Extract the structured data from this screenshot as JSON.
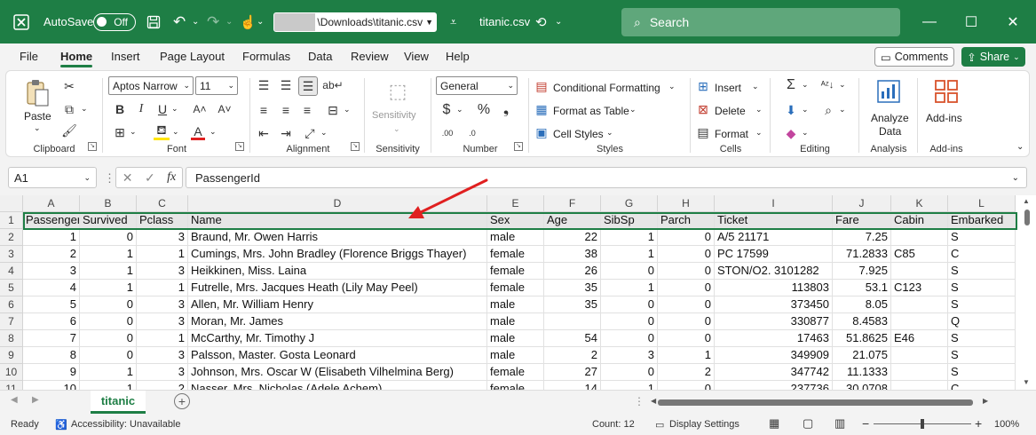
{
  "titlebar": {
    "autosave_label": "AutoSave",
    "autosave_state": "Off",
    "path": "\\Downloads\\titanic.csv",
    "filename": "titanic.csv",
    "search_placeholder": "Search"
  },
  "ribbon_tabs": [
    "File",
    "Home",
    "Insert",
    "Page Layout",
    "Formulas",
    "Data",
    "Review",
    "View",
    "Help"
  ],
  "active_tab": "Home",
  "comments_label": "Comments",
  "share_label": "Share",
  "ribbon": {
    "clipboard": {
      "paste": "Paste",
      "label": "Clipboard"
    },
    "font": {
      "name": "Aptos Narrow",
      "size": "11",
      "label": "Font"
    },
    "alignment": {
      "label": "Alignment"
    },
    "sensitivity": {
      "button": "Sensitivity",
      "label": "Sensitivity"
    },
    "number": {
      "format": "General",
      "label": "Number"
    },
    "styles": {
      "conditional": "Conditional Formatting",
      "table": "Format as Table",
      "cell_styles": "Cell Styles",
      "label": "Styles"
    },
    "cells": {
      "insert": "Insert",
      "delete": "Delete",
      "format": "Format",
      "label": "Cells"
    },
    "editing": {
      "label": "Editing"
    },
    "analysis": {
      "analyze_line1": "Analyze",
      "analyze_line2": "Data",
      "label": "Analysis"
    },
    "addins": {
      "button": "Add-ins",
      "label": "Add-ins"
    }
  },
  "formula_bar": {
    "namebox": "A1",
    "fx": "fx",
    "content": "PassengerId"
  },
  "columns": [
    "A",
    "B",
    "C",
    "D",
    "E",
    "F",
    "G",
    "H",
    "I",
    "J",
    "K",
    "L"
  ],
  "rows": [
    [
      "Passenger",
      "Survived",
      "Pclass",
      "Name",
      "Sex",
      "Age",
      "SibSp",
      "Parch",
      "Ticket",
      "Fare",
      "Cabin",
      "Embarked"
    ],
    [
      "1",
      "0",
      "3",
      "Braund, Mr. Owen Harris",
      "male",
      "22",
      "1",
      "0",
      "A/5 21171",
      "7.25",
      "",
      "S"
    ],
    [
      "2",
      "1",
      "1",
      "Cumings, Mrs. John Bradley (Florence Briggs Thayer)",
      "female",
      "38",
      "1",
      "0",
      "PC 17599",
      "71.2833",
      "C85",
      "C"
    ],
    [
      "3",
      "1",
      "3",
      "Heikkinen, Miss. Laina",
      "female",
      "26",
      "0",
      "0",
      "STON/O2. 3101282",
      "7.925",
      "",
      "S"
    ],
    [
      "4",
      "1",
      "1",
      "Futrelle, Mrs. Jacques Heath (Lily May Peel)",
      "female",
      "35",
      "1",
      "0",
      "113803",
      "53.1",
      "C123",
      "S"
    ],
    [
      "5",
      "0",
      "3",
      "Allen, Mr. William Henry",
      "male",
      "35",
      "0",
      "0",
      "373450",
      "8.05",
      "",
      "S"
    ],
    [
      "6",
      "0",
      "3",
      "Moran, Mr. James",
      "male",
      "",
      "0",
      "0",
      "330877",
      "8.4583",
      "",
      "Q"
    ],
    [
      "7",
      "0",
      "1",
      "McCarthy, Mr. Timothy J",
      "male",
      "54",
      "0",
      "0",
      "17463",
      "51.8625",
      "E46",
      "S"
    ],
    [
      "8",
      "0",
      "3",
      "Palsson, Master. Gosta Leonard",
      "male",
      "2",
      "3",
      "1",
      "349909",
      "21.075",
      "",
      "S"
    ],
    [
      "9",
      "1",
      "3",
      "Johnson, Mrs. Oscar W (Elisabeth Vilhelmina Berg)",
      "female",
      "27",
      "0",
      "2",
      "347742",
      "11.1333",
      "",
      "S"
    ],
    [
      "10",
      "1",
      "2",
      "Nasser, Mrs. Nicholas (Adele Achem)",
      "female",
      "14",
      "1",
      "0",
      "237736",
      "30.0708",
      "",
      "C"
    ]
  ],
  "sheet": {
    "name": "titanic"
  },
  "status": {
    "ready": "Ready",
    "accessibility": "Accessibility: Unavailable",
    "count": "Count: 12",
    "display_settings": "Display Settings",
    "zoom": "100%"
  },
  "colors": {
    "accent": "#1e7e45",
    "arrow": "#e02020"
  }
}
